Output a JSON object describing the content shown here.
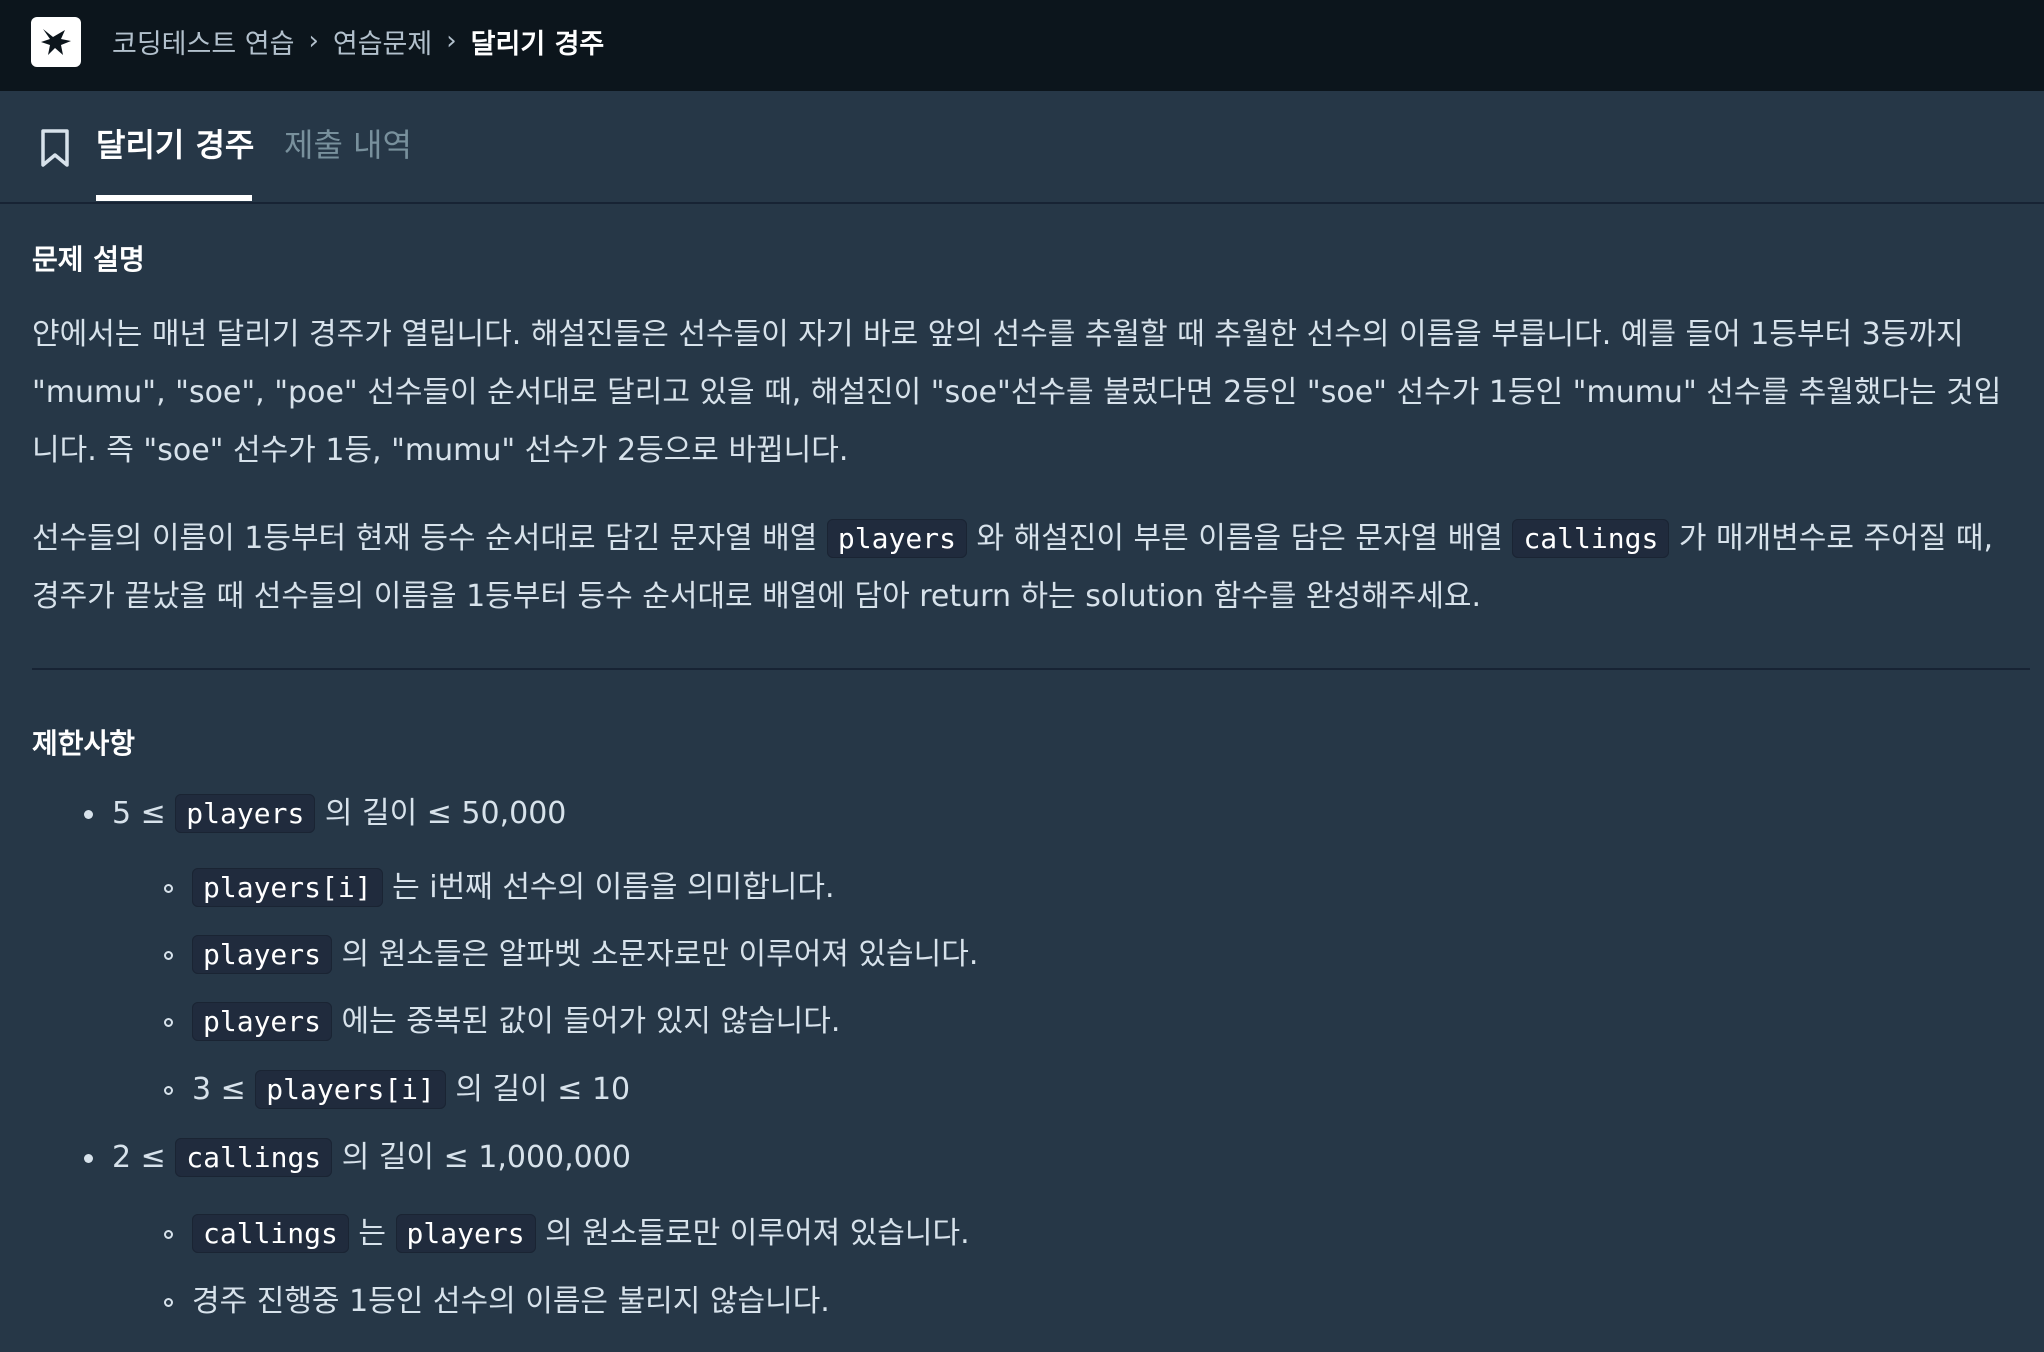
{
  "breadcrumb": {
    "items": [
      "코딩테스트 연습",
      "연습문제",
      "달리기 경주"
    ]
  },
  "tabs": {
    "active": "달리기 경주",
    "inactive": "제출 내역"
  },
  "description": {
    "heading": "문제 설명",
    "para1": "얀에서는 매년 달리기 경주가 열립니다. 해설진들은 선수들이 자기 바로 앞의 선수를 추월할 때 추월한 선수의 이름을 부릅니다. 예를 들어 1등부터 3등까지 \"mumu\", \"soe\", \"poe\" 선수들이 순서대로 달리고 있을 때, 해설진이 \"soe\"선수를 불렀다면 2등인 \"soe\" 선수가 1등인 \"mumu\" 선수를 추월했다는 것입니다. 즉 \"soe\" 선수가 1등, \"mumu\" 선수가 2등으로 바뀝니다.",
    "para2_a": "선수들의 이름이 1등부터 현재 등수 순서대로 담긴 문자열 배열 ",
    "para2_code1": "players",
    "para2_b": " 와 해설진이 부른 이름을 담은 문자열 배열 ",
    "para2_code2": "callings",
    "para2_c": " 가 매개변수로 주어질 때, 경주가 끝났을 때 선수들의 이름을 1등부터 등수 순서대로 배열에 담아 return 하는 solution 함수를 완성해주세요."
  },
  "constraints": {
    "heading": "제한사항",
    "items": [
      {
        "pre": "5 ≤ ",
        "code": "players",
        "post": " 의 길이 ≤ 50,000"
      },
      {
        "pre": "",
        "code": "players[i]",
        "post": " 는 i번째 선수의 이름을 의미합니다."
      },
      {
        "pre": "",
        "code": "players",
        "post": " 의 원소들은 알파벳 소문자로만 이루어져 있습니다."
      },
      {
        "pre": "",
        "code": "players",
        "post": " 에는 중복된 값이 들어가 있지 않습니다."
      },
      {
        "pre": "3 ≤ ",
        "code": "players[i]",
        "post": " 의 길이 ≤ 10"
      },
      {
        "pre": "2 ≤ ",
        "code": "callings",
        "post": " 의 길이 ≤ 1,000,000"
      },
      {
        "pre": "",
        "code": "callings",
        "mid": " 는 ",
        "code2": "players",
        "post": " 의 원소들로만 이루어져 있습니다."
      },
      {
        "pre": "경주 진행중 1등인 선수의 이름은 불리지 않습니다.",
        "code": "",
        "post": ""
      }
    ]
  }
}
